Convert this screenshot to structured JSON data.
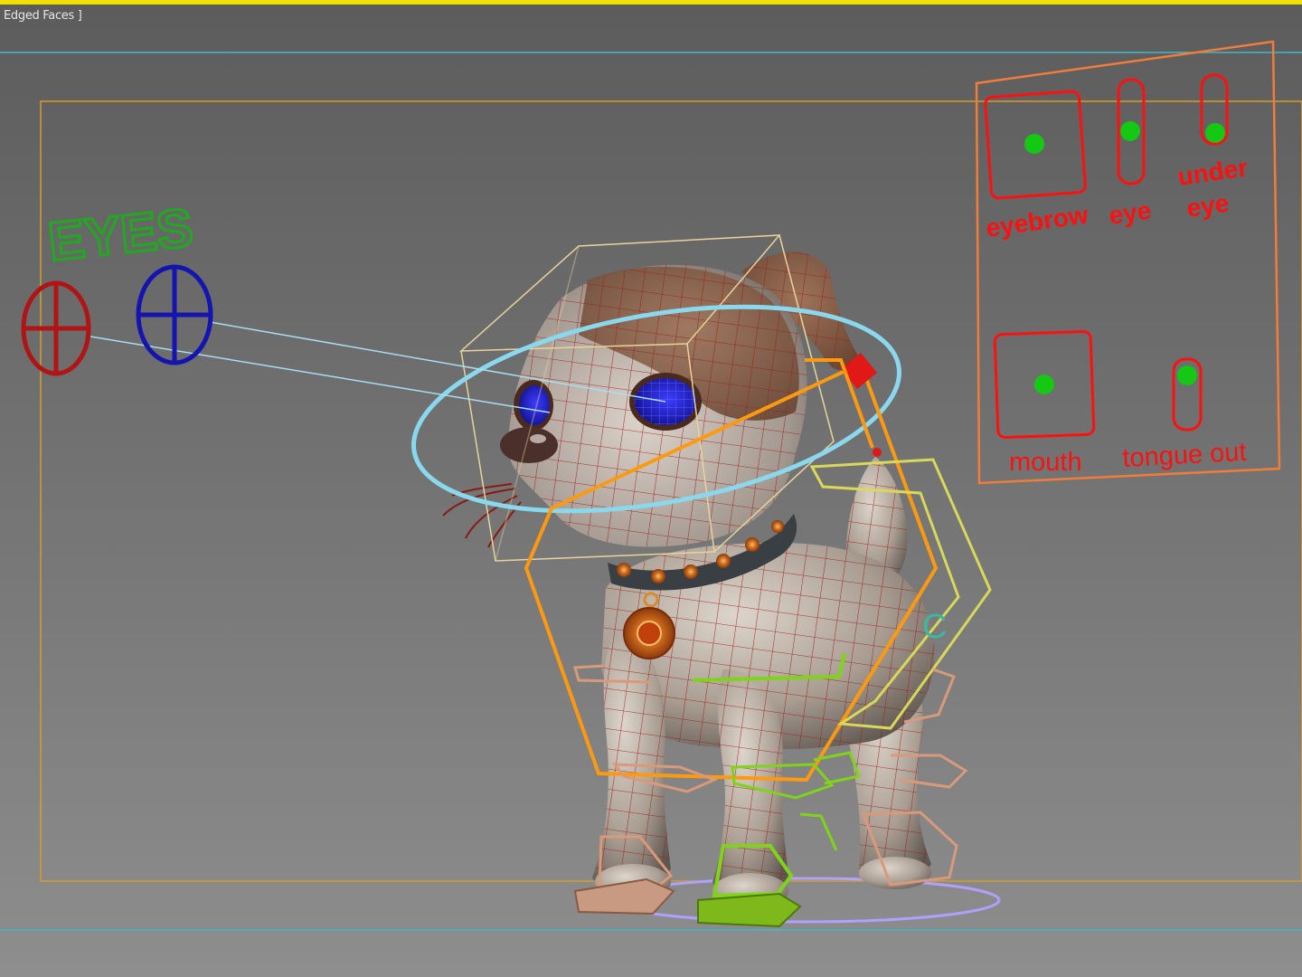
{
  "viewport": {
    "label": "Edged Faces ]",
    "colors": {
      "background_top": "#5c5c5c",
      "background_bottom": "#8e8e8e",
      "active_border": "#f0e000",
      "grid_line": "#40b8c8",
      "safe_frame": "#d69c2e",
      "wire": "#9a1f14"
    }
  },
  "eyes_control": {
    "title": "EYES",
    "title_color": "#1faa1f",
    "left_eye_color": "#b01515",
    "right_eye_color": "#1414b0"
  },
  "face_panel": {
    "border_color": "#f07d3a",
    "label_color": "#ff1010",
    "knob_color": "#14c814",
    "labels": {
      "eyebrow": "eyebrow",
      "eye": "eye",
      "under_eye_line1": "under",
      "under_eye_line2": "eye",
      "mouth": "mouth",
      "tongue_out": "tongue out"
    }
  },
  "rig": {
    "head_ring_color": "#8ad8ee",
    "body_hex_color": "#ff9a10",
    "spine_hex_color": "#d8d85a",
    "front_foot_color": "#7fd41a",
    "back_foot_color": "#d89a7a",
    "ground_ring_color": "#b0a0ff",
    "cog_label": "C"
  }
}
